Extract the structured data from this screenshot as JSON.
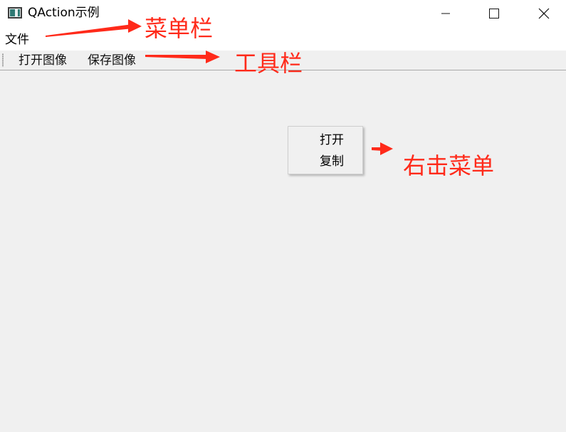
{
  "window": {
    "title": "QAction示例"
  },
  "menubar": {
    "file_label": "文件"
  },
  "toolbar": {
    "open_image_label": "打开图像",
    "save_image_label": "保存图像"
  },
  "context_menu": {
    "items": [
      {
        "label": "打开"
      },
      {
        "label": "复制"
      }
    ]
  },
  "annotations": {
    "menubar_label": "菜单栏",
    "toolbar_label": "工具栏",
    "context_menu_label": "右击菜单",
    "color": "#ff2a1a"
  },
  "icons": {
    "app": "window-app-icon",
    "minimize": "minimize-icon",
    "maximize": "maximize-icon",
    "close": "close-icon"
  }
}
